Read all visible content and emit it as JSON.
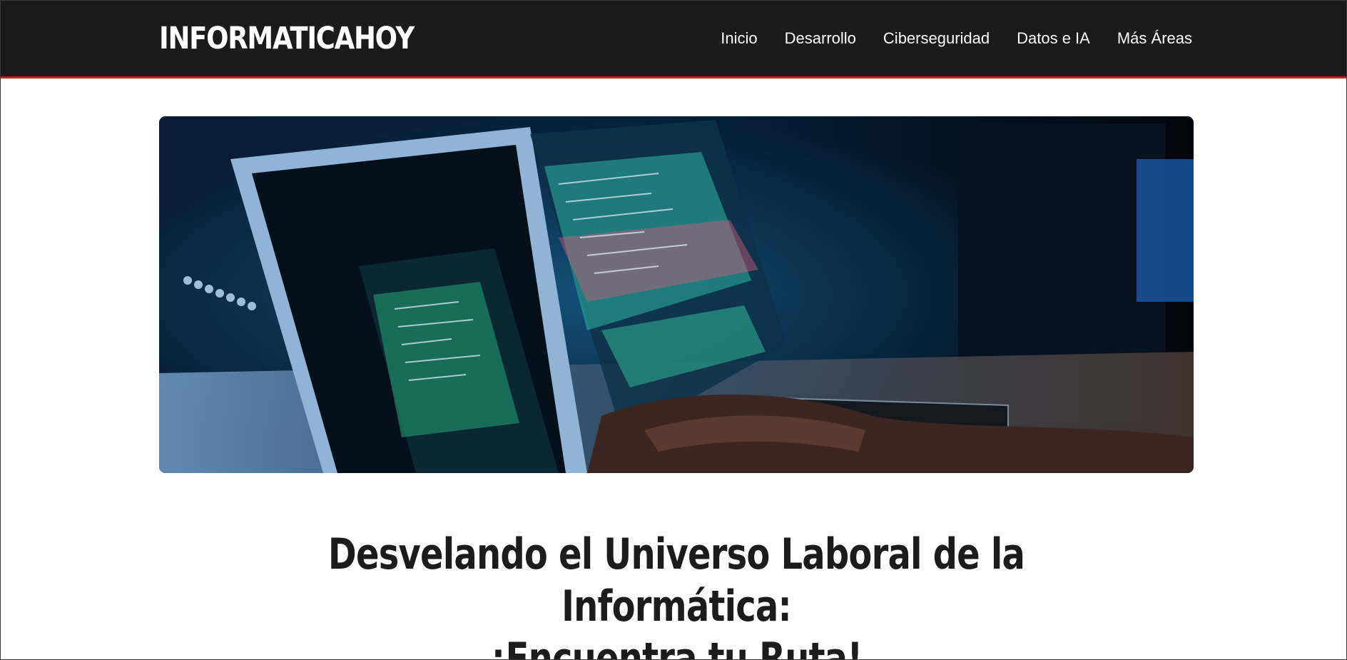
{
  "site": {
    "logo_text": "INFORMATICAHOY",
    "accent_color": "#c81d1d",
    "header_bg": "#1b1b1b"
  },
  "nav": {
    "items": [
      {
        "label": "Inicio"
      },
      {
        "label": "Desarrollo"
      },
      {
        "label": "Ciberseguridad"
      },
      {
        "label": "Datos e IA"
      },
      {
        "label": "Más Áreas"
      }
    ]
  },
  "hero": {
    "icon": "laptop-code-illustration"
  },
  "article": {
    "title_line1": "Desvelando el Universo Laboral de la Informática:",
    "title_line2": "¡Encuentra tu Ruta!"
  }
}
